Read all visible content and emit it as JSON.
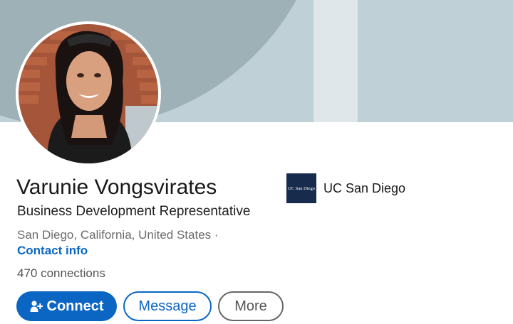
{
  "profile": {
    "name": "Varunie Vongsvirates",
    "headline": "Business Development Representative",
    "location": "San Diego, California, United States ·",
    "contact_label": "Contact info",
    "connections": "470 connections"
  },
  "organization": {
    "logo_text": "UC San Diego",
    "name": "UC San Diego"
  },
  "actions": {
    "connect_label": "Connect",
    "message_label": "Message",
    "more_label": "More"
  },
  "icons": {
    "connect": "add-person-icon"
  },
  "colors": {
    "accent": "#0a66c2",
    "banner": "#bfd1d7",
    "logo_bg": "#172b4d"
  }
}
